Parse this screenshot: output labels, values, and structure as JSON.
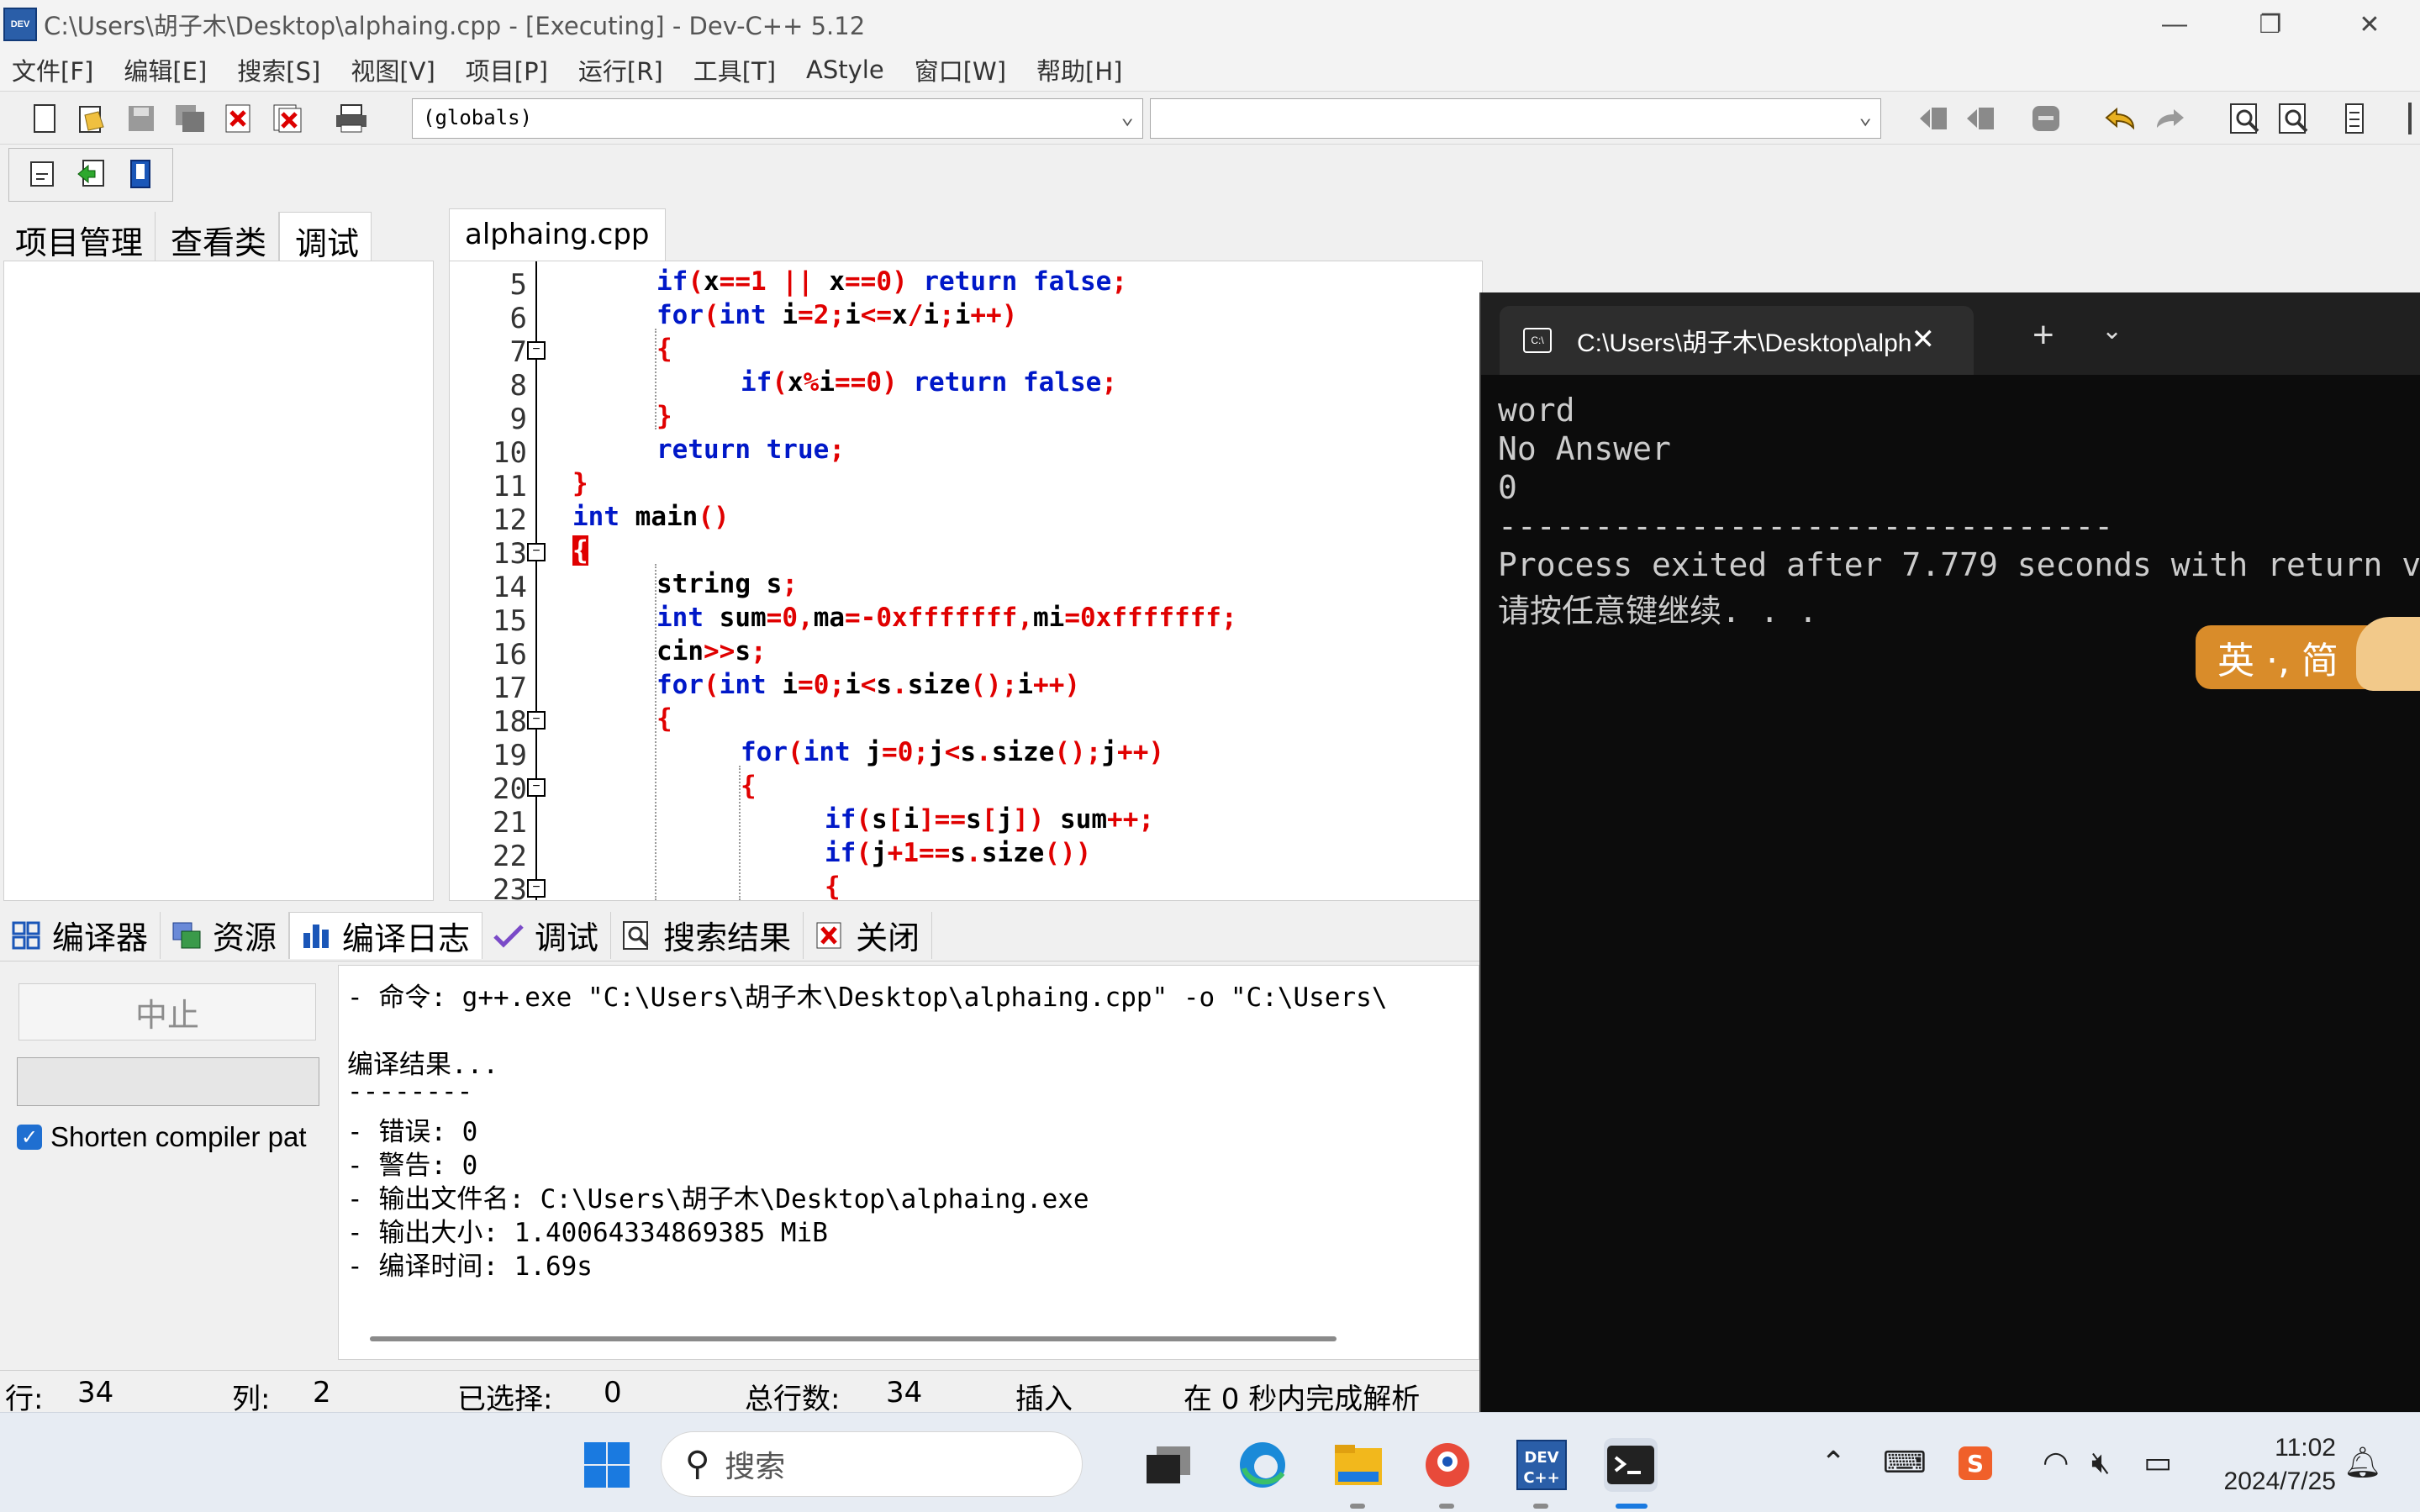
{
  "window": {
    "title": "C:\\Users\\胡子木\\Desktop\\alphaing.cpp - [Executing] - Dev-C++ 5.12",
    "app_icon_label": "DEV",
    "minimize": "—",
    "maximize": "❐",
    "close": "✕"
  },
  "menu": [
    "文件[F]",
    "编辑[E]",
    "搜索[S]",
    "视图[V]",
    "项目[P]",
    "运行[R]",
    "工具[T]",
    "AStyle",
    "窗口[W]",
    "帮助[H]"
  ],
  "toolbar": {
    "scope_combo": "(globals)",
    "member_combo": ""
  },
  "left_panel": {
    "tabs": [
      "项目管理",
      "查看类",
      "调试"
    ],
    "active_tab": "调试"
  },
  "editor": {
    "tab": "alphaing.cpp",
    "line_numbers": [
      "5",
      "6",
      "7",
      "8",
      "9",
      "10",
      "11",
      "12",
      "13",
      "14",
      "15",
      "16",
      "17",
      "18",
      "19",
      "20",
      "21",
      "22",
      "23"
    ]
  },
  "bottom_panel": {
    "tabs": [
      "编译器",
      "资源",
      "编译日志",
      "调试",
      "搜索结果",
      "关闭"
    ],
    "active_tab": "编译日志",
    "stop_button": "中止",
    "shorten_checkbox": "Shorten compiler pat",
    "log": [
      "- 命令: g++.exe \"C:\\Users\\胡子木\\Desktop\\alphaing.cpp\" -o \"C:\\Users\\",
      "",
      "编译结果...",
      "--------",
      "- 错误: 0",
      "- 警告: 0",
      "- 输出文件名: C:\\Users\\胡子木\\Desktop\\alphaing.exe",
      "- 输出大小: 1.40064334869385 MiB",
      "- 编译时间: 1.69s"
    ]
  },
  "statusbar": {
    "row_label": "行:",
    "row": "34",
    "col_label": "列:",
    "col": "2",
    "sel_label": "已选择:",
    "sel": "0",
    "total_label": "总行数:",
    "total": "34",
    "mode": "插入",
    "parse": "在 0 秒内完成解析"
  },
  "terminal": {
    "tab_title": "C:\\Users\\胡子木\\Desktop\\alph",
    "plus": "+",
    "dropdown": "⌄",
    "output": [
      "word",
      "No Answer",
      "0",
      "--------------------------------",
      "Process exited after 7.779 seconds with return v",
      "请按任意键继续. . ."
    ],
    "ime_badge": "英 ·, 简"
  },
  "taskbar": {
    "search_placeholder": "搜索",
    "time": "11:02",
    "date": "2024/7/25"
  }
}
